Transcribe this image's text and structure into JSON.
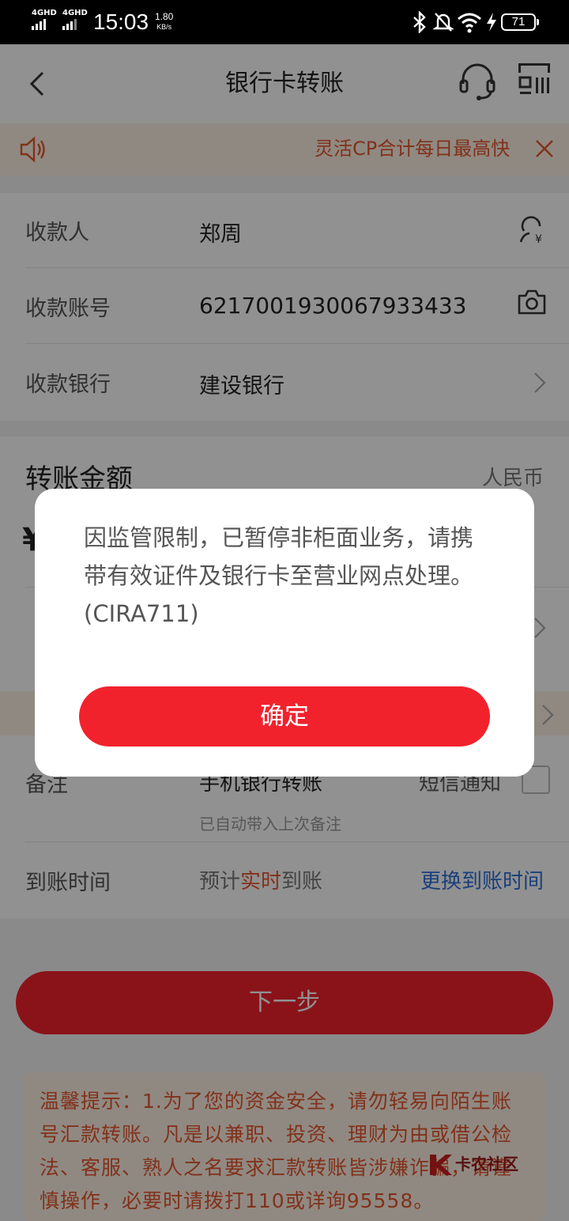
{
  "status_bar": {
    "network1": "4GHD",
    "network2": "4GHD",
    "time": "15:03",
    "speed_value": "1.80",
    "speed_unit": "KB/s",
    "battery": "71"
  },
  "header": {
    "title": "银行卡转账"
  },
  "notice": {
    "text": "灵活CP合计每日最高快"
  },
  "payee": {
    "name_label": "收款人",
    "name_value": "郑周",
    "account_label": "收款账号",
    "account_value": "6217001930067933433",
    "bank_label": "收款银行",
    "bank_value": "建设银行"
  },
  "amount": {
    "title": "转账金额",
    "currency": "人民币"
  },
  "remark": {
    "label": "备注",
    "value": "手机银行转账",
    "hint": "已自动带入上次备注",
    "sms_label": "短信通知"
  },
  "arrival": {
    "label": "到账时间",
    "value_prefix": "预计",
    "value_highlight": "实时",
    "value_suffix": "到账",
    "change_link": "更换到账时间"
  },
  "next_button": "下一步",
  "tip": "温馨提示：1.为了您的资金安全，请勿轻易向陌生账号汇款转账。凡是以兼职、投资、理财为由或借公检法、客服、熟人之名要求汇款转账皆涉嫌诈骗，请谨慎操作，必要时请拨打110或详询95558。",
  "watermark": "卡农社区",
  "dialog": {
    "message": "因监管限制，已暂停非柜面业务，请携带有效证件及银行卡至营业网点处理。(CIRA711)",
    "confirm": "确定"
  },
  "colors": {
    "accent": "#f2222d",
    "notice_text": "#e4572e",
    "link": "#2f6fd6"
  }
}
